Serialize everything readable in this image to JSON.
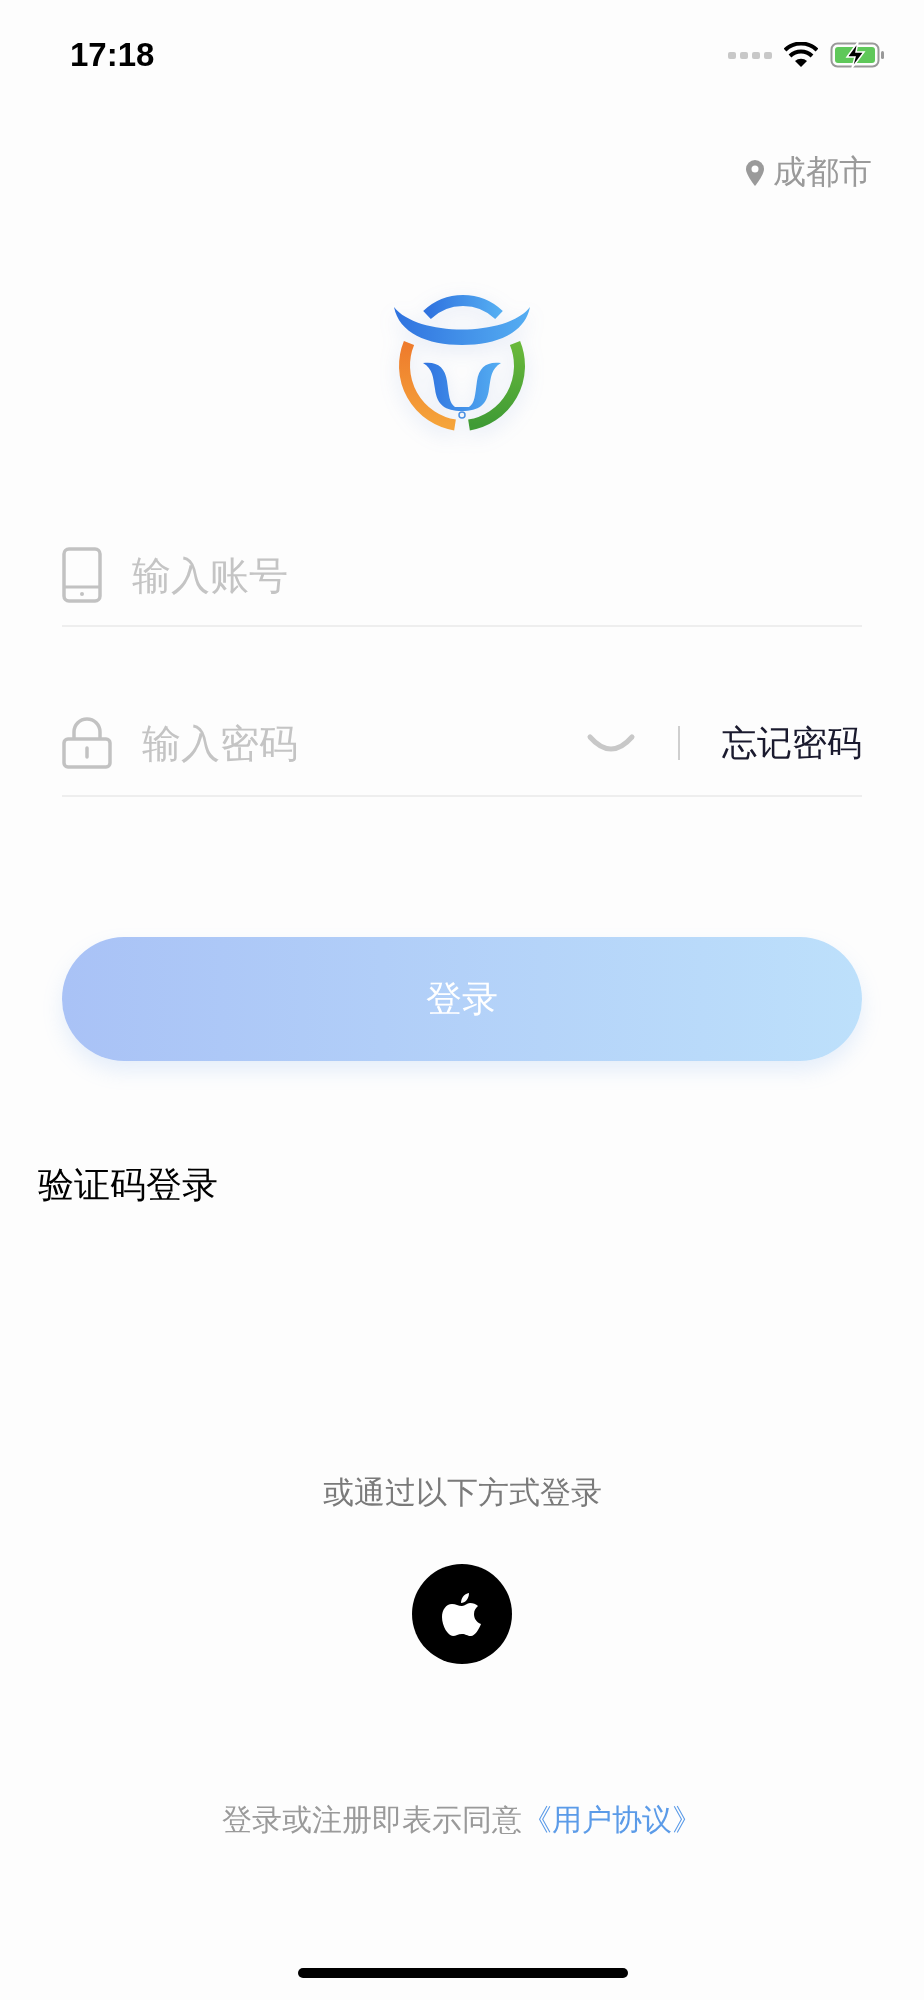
{
  "status_bar": {
    "time": "17:18",
    "charging": true
  },
  "location": "成都市",
  "account_field": {
    "placeholder": "输入账号"
  },
  "password_field": {
    "placeholder": "输入密码",
    "password_visible": false
  },
  "forgot_password": "忘记密码",
  "login_button": {
    "label": "登录",
    "disabled": true
  },
  "code_login": "验证码登录",
  "alt_login_label": "或通过以下方式登录",
  "agreement": {
    "text": "登录或注册即表示同意",
    "link": "《用户协议》"
  }
}
